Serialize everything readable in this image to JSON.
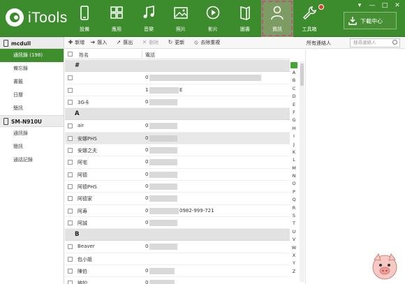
{
  "app": {
    "logo_text": "iTools"
  },
  "nav": {
    "items": [
      {
        "label": "設備",
        "icon": "phone-icon"
      },
      {
        "label": "應用",
        "icon": "apps-grid-icon"
      },
      {
        "label": "音樂",
        "icon": "music-note-icon"
      },
      {
        "label": "照片",
        "icon": "photo-icon"
      },
      {
        "label": "影片",
        "icon": "play-circle-icon"
      },
      {
        "label": "圖書",
        "icon": "book-icon"
      },
      {
        "label": "資訊",
        "icon": "person-icon",
        "active": true
      },
      {
        "label": "工具箱",
        "icon": "wrench-icon"
      }
    ],
    "download_label": "下載中心"
  },
  "window": {
    "minimize": "—",
    "maximize": "□",
    "close": "✕"
  },
  "sidebar": {
    "devices": [
      {
        "name": "mcdull",
        "items": [
          {
            "label": "通訊錄 (198)",
            "active": true
          },
          {
            "label": "備忘錄"
          },
          {
            "label": "書籤"
          },
          {
            "label": "日曆"
          },
          {
            "label": "簡訊"
          }
        ]
      },
      {
        "name": "SM-N910U",
        "items": [
          {
            "label": "通訊錄"
          },
          {
            "label": "簡訊"
          },
          {
            "label": "通話記錄"
          }
        ]
      }
    ]
  },
  "toolbar": {
    "new": "新增",
    "import": "匯入",
    "export": "匯出",
    "delete": "刪除",
    "refresh": "更新",
    "dedupe": "去除重複",
    "filter_label": "所有連絡人",
    "search_placeholder": "搜尋連絡人"
  },
  "table": {
    "col_name": "姓名",
    "col_phone": "電話",
    "rows": [
      {
        "type": "group",
        "label": "#"
      },
      {
        "type": "row",
        "name": "",
        "phone": "0",
        "blur_w": 160
      },
      {
        "type": "row",
        "name": "",
        "phone": "1",
        "tail": "E",
        "blur_w": 42
      },
      {
        "type": "row",
        "name": "3G卡",
        "phone": "0",
        "blur_w": 40
      },
      {
        "type": "group",
        "label": "A"
      },
      {
        "type": "row",
        "name": "air",
        "phone": "0",
        "blur_w": 40
      },
      {
        "type": "row",
        "name": "安娜PHS",
        "phone": "0",
        "blur_w": 40,
        "hl": true
      },
      {
        "type": "row",
        "name": "安娜之夫",
        "phone": "0",
        "blur_w": 40
      },
      {
        "type": "row",
        "name": "阿宅",
        "phone": "0",
        "blur_w": 40
      },
      {
        "type": "row",
        "name": "阿德",
        "phone": "0",
        "blur_w": 40
      },
      {
        "type": "row",
        "name": "阿德PHS",
        "phone": "0",
        "blur_w": 40
      },
      {
        "type": "row",
        "name": "阿德家",
        "phone": "0",
        "blur_w": 40
      },
      {
        "type": "row",
        "name": "阿寿",
        "phone": "0",
        "tail": "0982-999-721",
        "blur_w": 42
      },
      {
        "type": "row",
        "name": "阿誠",
        "phone": "0",
        "blur_w": 40
      },
      {
        "type": "group",
        "label": "B"
      },
      {
        "type": "row",
        "name": "Beaver",
        "phone": "0",
        "blur_w": 40
      },
      {
        "type": "row",
        "name": "包小姐",
        "phone": "",
        "blur_w": 0
      },
      {
        "type": "row",
        "name": "陳伯",
        "phone": "0",
        "blur_w": 36
      },
      {
        "type": "row",
        "name": "彼的",
        "phone": "0",
        "blur_w": 36
      }
    ]
  },
  "alphabet": [
    "A",
    "B",
    "C",
    "D",
    "E",
    "F",
    "G",
    "H",
    "I",
    "J",
    "K",
    "L",
    "M",
    "N",
    "O",
    "P",
    "Q",
    "R",
    "S",
    "T",
    "U",
    "V",
    "W",
    "X",
    "Y",
    "Z"
  ],
  "colors": {
    "brand": "#3c8b2c",
    "active_nav": "#7d9c63",
    "notify": "#e23b2e"
  }
}
